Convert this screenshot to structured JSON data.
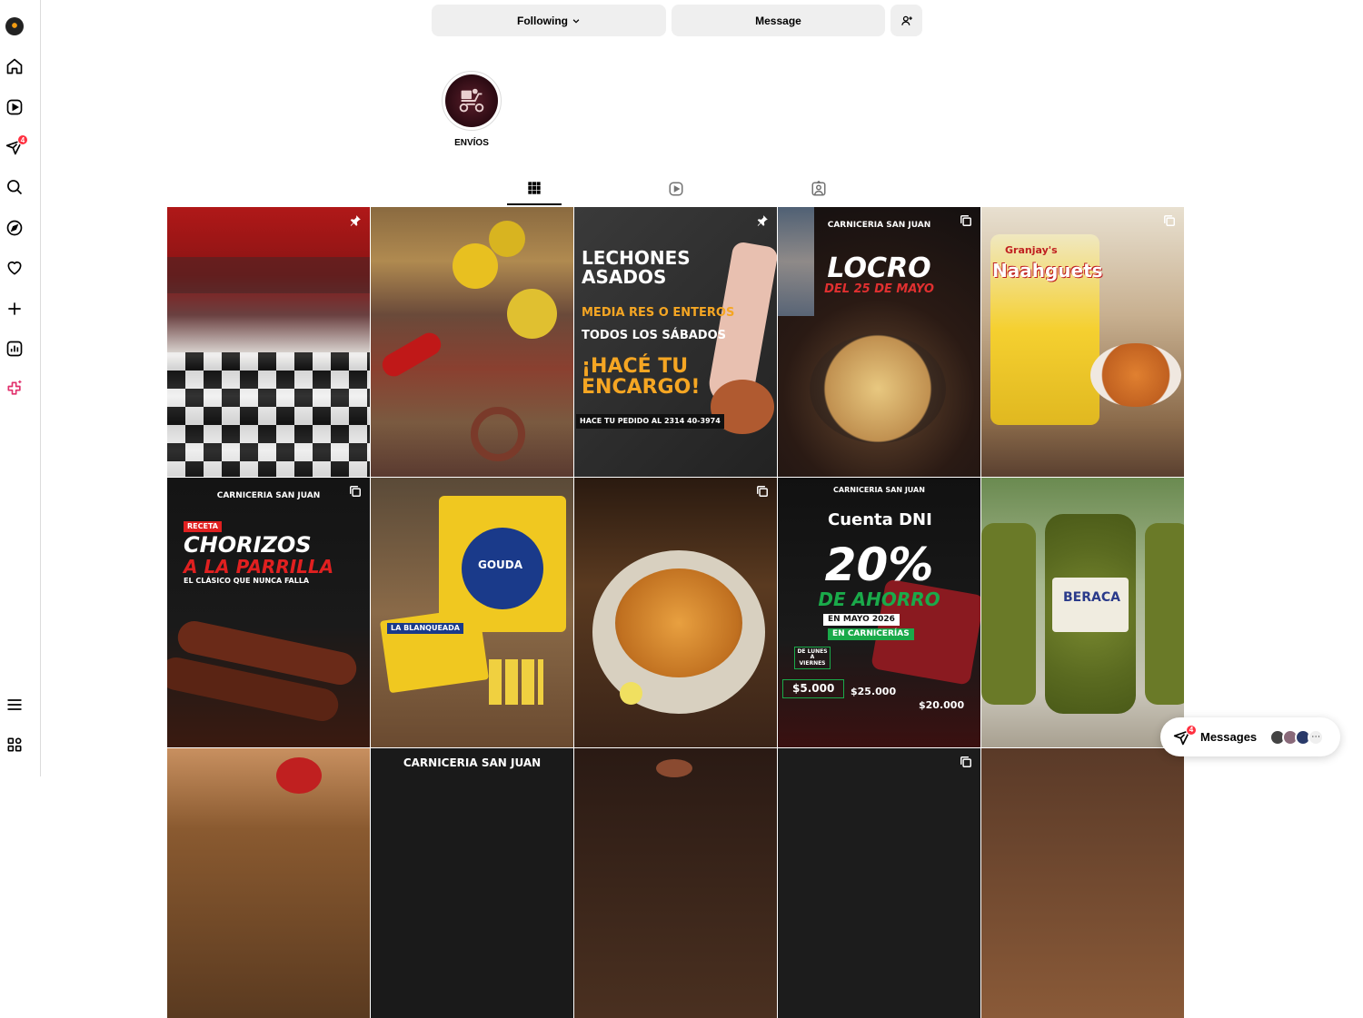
{
  "sidebar": {
    "items": [
      {
        "icon": "profile-logo-icon"
      },
      {
        "icon": "home-icon"
      },
      {
        "icon": "reels-icon"
      },
      {
        "icon": "messages-icon",
        "badge": "4"
      },
      {
        "icon": "search-icon"
      },
      {
        "icon": "explore-icon"
      },
      {
        "icon": "notifications-heart-icon"
      },
      {
        "icon": "create-plus-icon"
      },
      {
        "icon": "dashboard-icon"
      },
      {
        "icon": "meta-ai-icon"
      },
      {
        "icon": "menu-icon"
      },
      {
        "icon": "also-from-meta-icon"
      }
    ]
  },
  "profile": {
    "following_label": "Following",
    "message_label": "Message"
  },
  "highlights": [
    {
      "label": "ENVÍOS"
    }
  ],
  "tabs": [
    {
      "icon": "grid-icon",
      "active": true
    },
    {
      "icon": "reels-icon",
      "active": false
    },
    {
      "icon": "tagged-icon",
      "active": false
    }
  ],
  "posts": [
    {
      "bg": "#8b1e1e",
      "corner": "pin-icon",
      "text": ""
    },
    {
      "bg": "#7a5a3a",
      "corner": "",
      "text": ""
    },
    {
      "bg": "#2b2b2b",
      "corner": "pin-icon",
      "text": "LECHONES ASADOS",
      "sub": "MEDIA RES O ENTEROS",
      "sub2": "TODOS LOS SÁBADOS",
      "cta": "¡HACÉ TU ENCARGO!",
      "phone": "HACE TU PEDIDO AL  2314 40-3974"
    },
    {
      "bg": "#1e1a18",
      "corner": "carousel-icon",
      "brand": "CARNICERIA SAN JUAN",
      "text": "LOCRO",
      "sub": "DEL 25 DE MAYO"
    },
    {
      "bg": "#9a7a50",
      "corner": "carousel-icon",
      "text": "Naahguets",
      "brand": "Granjay's"
    },
    {
      "bg": "#1a1a1a",
      "corner": "carousel-icon",
      "brand": "CARNICERIA SAN JUAN",
      "tag": "RECETA",
      "text": "CHORIZOS",
      "sub": "A LA PARRILLA",
      "sub2": "EL CLÁSICO QUE NUNCA FALLA"
    },
    {
      "bg": "#7a5a30",
      "corner": "",
      "text": "GOUDA",
      "brand": "LA BLANQUEADA"
    },
    {
      "bg": "#5a3a20",
      "corner": "carousel-icon",
      "text": ""
    },
    {
      "bg": "#111111",
      "corner": "",
      "brand": "CARNICERIA SAN JUAN",
      "text": "Cuenta DNI",
      "big": "20%",
      "sub": "DE AHORRO",
      "sub2": "EN MAYO 2026",
      "sub3": "EN CARNICERÍAS",
      "d1": "DE LUNES A VIERNES",
      "d2": "$5.000",
      "d3": "$25.000",
      "d4": "$20.000"
    },
    {
      "bg": "#8a9a70",
      "corner": "",
      "text": "BERACA"
    },
    {
      "bg": "#a06a40",
      "corner": "",
      "text": ""
    },
    {
      "bg": "#1a1a1a",
      "corner": "",
      "brand": "CARNICERIA SAN JUAN",
      "text": ""
    },
    {
      "bg": "#4a3020",
      "corner": "",
      "text": ""
    },
    {
      "bg": "#1c1c1c",
      "corner": "carousel-icon",
      "text": ""
    },
    {
      "bg": "#5a3a28",
      "corner": "",
      "text": ""
    }
  ],
  "messages_bar": {
    "label": "Messages",
    "badge": "4"
  }
}
